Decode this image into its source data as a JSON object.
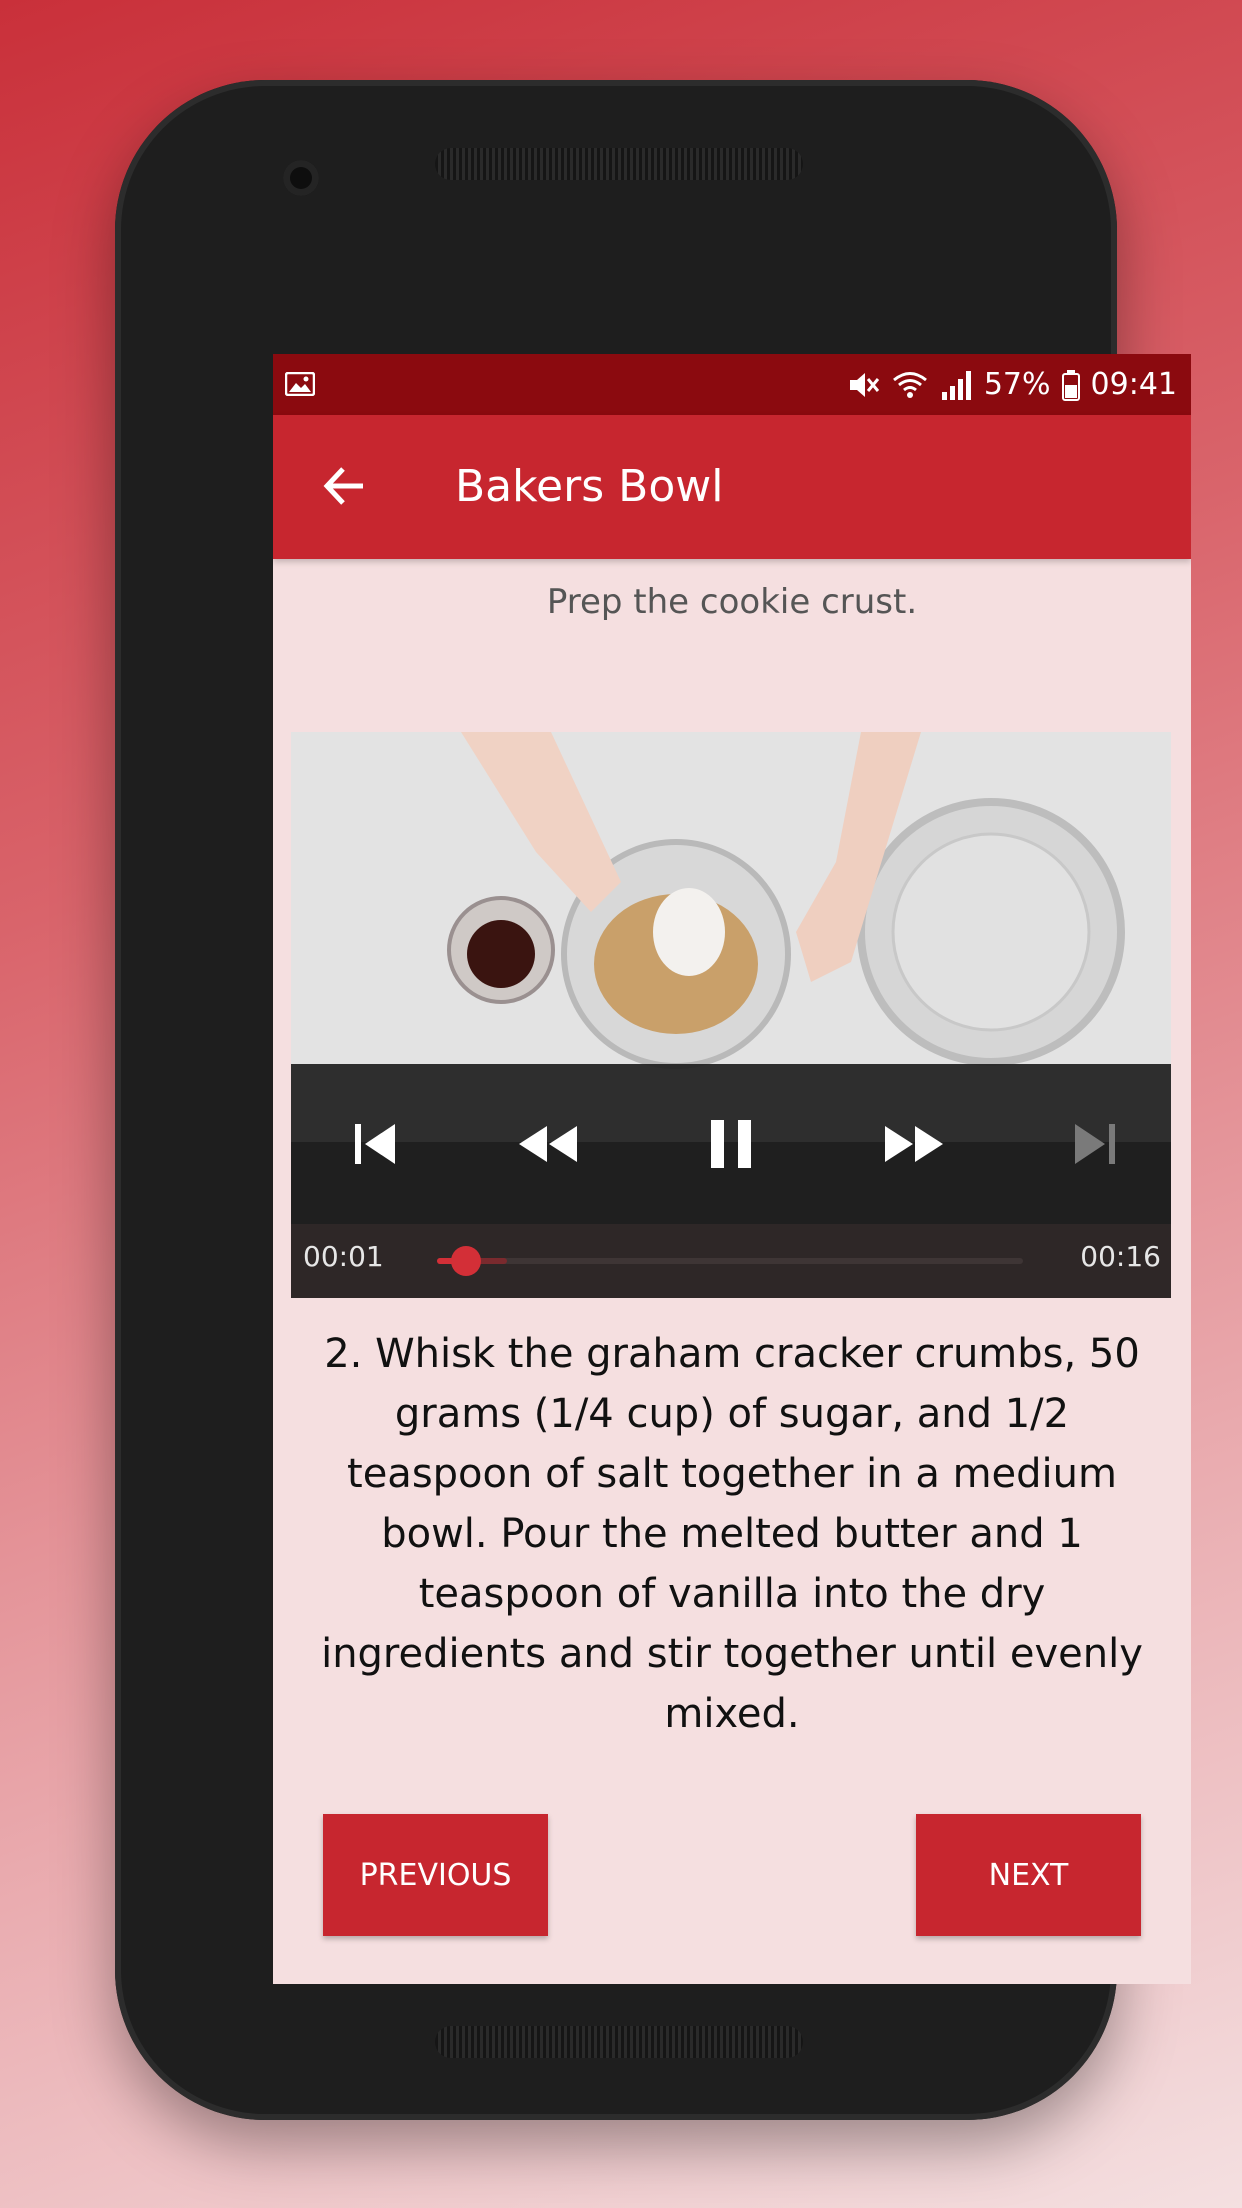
{
  "statusbar": {
    "battery": "57%",
    "time": "09:41"
  },
  "toolbar": {
    "title": "Bakers Bowl"
  },
  "step": {
    "short_description": "Prep the cookie crust.",
    "description": "2. Whisk the graham cracker crumbs, 50 grams (1/4 cup) of sugar, and 1/2 teaspoon of salt together in a medium bowl. Pour the melted butter and 1 teaspoon of vanilla into the dry ingredients and stir together until evenly mixed."
  },
  "player": {
    "position": "00:01",
    "duration": "00:16",
    "played_fraction": 0.05,
    "buffered_fraction": 0.12,
    "icons": [
      "skip-previous-icon",
      "rewind-icon",
      "pause-icon",
      "fast-forward-icon",
      "skip-next-icon"
    ]
  },
  "buttons": {
    "previous_label": "PREVIOUS",
    "next_label": "NEXT"
  },
  "colors": {
    "primary": "#c7262f",
    "primary_dark": "#8b0a0f",
    "background": "#f5dfe0",
    "accent": "#d32f37"
  }
}
